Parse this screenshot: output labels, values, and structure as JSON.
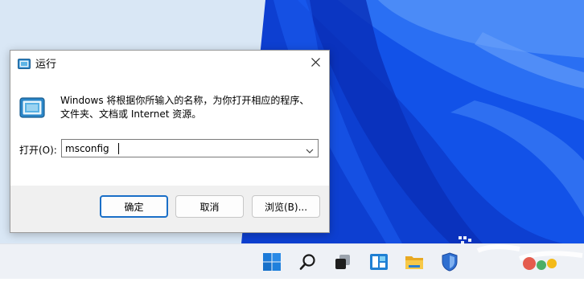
{
  "dialog": {
    "title": "运行",
    "description": "Windows 将根据你所输入的名称，为你打开相应的程序、文件夹、文档或 Internet 资源。",
    "open_label": "打开(O):",
    "open_value": "msconfig",
    "buttons": {
      "ok": "确定",
      "cancel": "取消",
      "browse": "浏览(B)..."
    },
    "icons": {
      "title": "run-icon",
      "big": "run-icon",
      "close": "close-icon",
      "dropdown": "chevron-down-icon"
    }
  },
  "taskbar": {
    "icons": [
      "windows-start-icon",
      "search-icon",
      "task-view-icon",
      "widgets-icon",
      "file-explorer-icon",
      "shield-icon"
    ]
  },
  "colors": {
    "accent": "#1a6fc7",
    "wallpaper_blue": "#1656e6",
    "taskbar_bg": "#eef1f6"
  }
}
